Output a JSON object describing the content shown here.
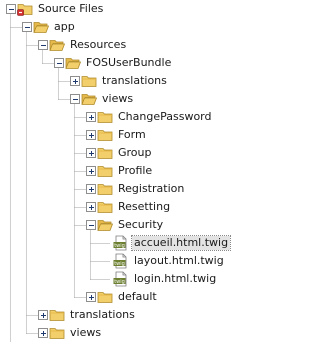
{
  "tree": [
    {
      "label": "Source Files",
      "icon": "project-source-folder-icon",
      "depth": 0,
      "toggle": "minus"
    },
    {
      "label": "app",
      "icon": "folder-open-icon",
      "depth": 1,
      "toggle": "minus"
    },
    {
      "label": "Resources",
      "icon": "folder-open-icon",
      "depth": 2,
      "toggle": "minus"
    },
    {
      "label": "FOSUserBundle",
      "icon": "folder-open-icon",
      "depth": 3,
      "toggle": "minus"
    },
    {
      "label": "translations",
      "icon": "folder-icon",
      "depth": 4,
      "toggle": "plus"
    },
    {
      "label": "views",
      "icon": "folder-open-icon",
      "depth": 4,
      "toggle": "minus"
    },
    {
      "label": "ChangePassword",
      "icon": "folder-icon",
      "depth": 5,
      "toggle": "plus"
    },
    {
      "label": "Form",
      "icon": "folder-icon",
      "depth": 5,
      "toggle": "plus"
    },
    {
      "label": "Group",
      "icon": "folder-icon",
      "depth": 5,
      "toggle": "plus"
    },
    {
      "label": "Profile",
      "icon": "folder-icon",
      "depth": 5,
      "toggle": "plus"
    },
    {
      "label": "Registration",
      "icon": "folder-icon",
      "depth": 5,
      "toggle": "plus"
    },
    {
      "label": "Resetting",
      "icon": "folder-icon",
      "depth": 5,
      "toggle": "plus"
    },
    {
      "label": "Security",
      "icon": "folder-open-icon",
      "depth": 5,
      "toggle": "minus"
    },
    {
      "label": "accueil.html.twig",
      "icon": "twig-file-icon",
      "depth": 6,
      "toggle": "none",
      "selected": true
    },
    {
      "label": "layout.html.twig",
      "icon": "twig-file-icon",
      "depth": 6,
      "toggle": "none"
    },
    {
      "label": "login.html.twig",
      "icon": "twig-file-icon",
      "depth": 6,
      "toggle": "none"
    },
    {
      "label": "default",
      "icon": "folder-icon",
      "depth": 5,
      "toggle": "plus"
    },
    {
      "label": "translations",
      "icon": "folder-icon",
      "depth": 2,
      "toggle": "plus"
    },
    {
      "label": "views",
      "icon": "folder-icon",
      "depth": 2,
      "toggle": "plus"
    }
  ],
  "icon_text": {
    "twig": "twig"
  },
  "colors": {
    "folder_fill": "#f2cf6a",
    "folder_stroke": "#b08a2b",
    "folder_tab": "#e6b94b",
    "file_badge": "#6b7f2f",
    "guide_line": "#a0a0a0",
    "toggle_border": "#8e8e8e",
    "toggle_sign": "#1f3a6e",
    "project_badge": "#d32f2f"
  }
}
